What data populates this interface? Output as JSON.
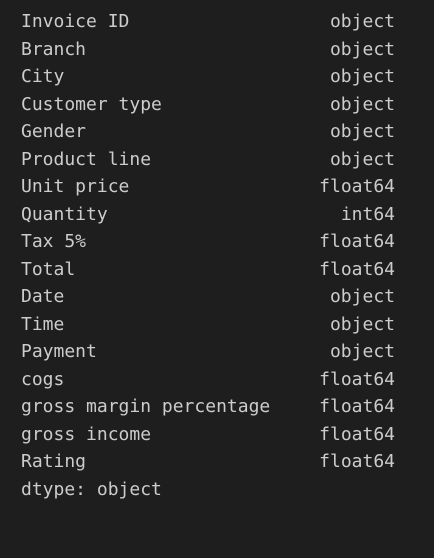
{
  "output": {
    "rows": [
      {
        "name": "Invoice ID",
        "dtype": "object"
      },
      {
        "name": "Branch",
        "dtype": "object"
      },
      {
        "name": "City",
        "dtype": "object"
      },
      {
        "name": "Customer type",
        "dtype": "object"
      },
      {
        "name": "Gender",
        "dtype": "object"
      },
      {
        "name": "Product line",
        "dtype": "object"
      },
      {
        "name": "Unit price",
        "dtype": "float64"
      },
      {
        "name": "Quantity",
        "dtype": "int64"
      },
      {
        "name": "Tax 5%",
        "dtype": "float64"
      },
      {
        "name": "Total",
        "dtype": "float64"
      },
      {
        "name": "Date",
        "dtype": "object"
      },
      {
        "name": "Time",
        "dtype": "object"
      },
      {
        "name": "Payment",
        "dtype": "object"
      },
      {
        "name": "cogs",
        "dtype": "float64"
      },
      {
        "name": "gross margin percentage",
        "dtype": "float64"
      },
      {
        "name": "gross income",
        "dtype": "float64"
      },
      {
        "name": "Rating",
        "dtype": "float64"
      }
    ],
    "footer": "dtype: object"
  },
  "colors": {
    "background": "#1e1e1e",
    "text": "#cccccc"
  }
}
